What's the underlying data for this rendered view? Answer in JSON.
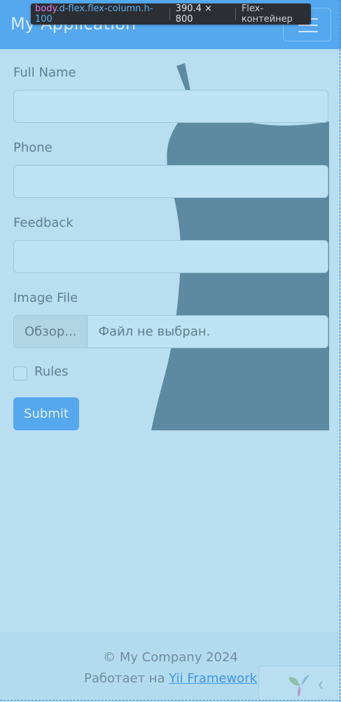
{
  "navbar": {
    "brand": "My Application"
  },
  "devtools": {
    "tag": "body",
    "classes": ".d-flex.flex-column.h-100",
    "size": "390.4 × 800",
    "type": "Flex-контейнер"
  },
  "form": {
    "full_name_label": "Full Name",
    "phone_label": "Phone",
    "feedback_label": "Feedback",
    "image_label": "Image File",
    "browse_label": "Обзор...",
    "no_file": "Файл не выбран.",
    "rules_label": "Rules",
    "submit_label": "Submit"
  },
  "footer": {
    "copyright": "© My Company 2024",
    "powered_prefix": "Работает на ",
    "powered_link": "Yii Framework"
  },
  "icons": {
    "menu": "hamburger-menu-icon",
    "yii": "yii-logo-icon",
    "collapse": "chevron-left-icon"
  }
}
